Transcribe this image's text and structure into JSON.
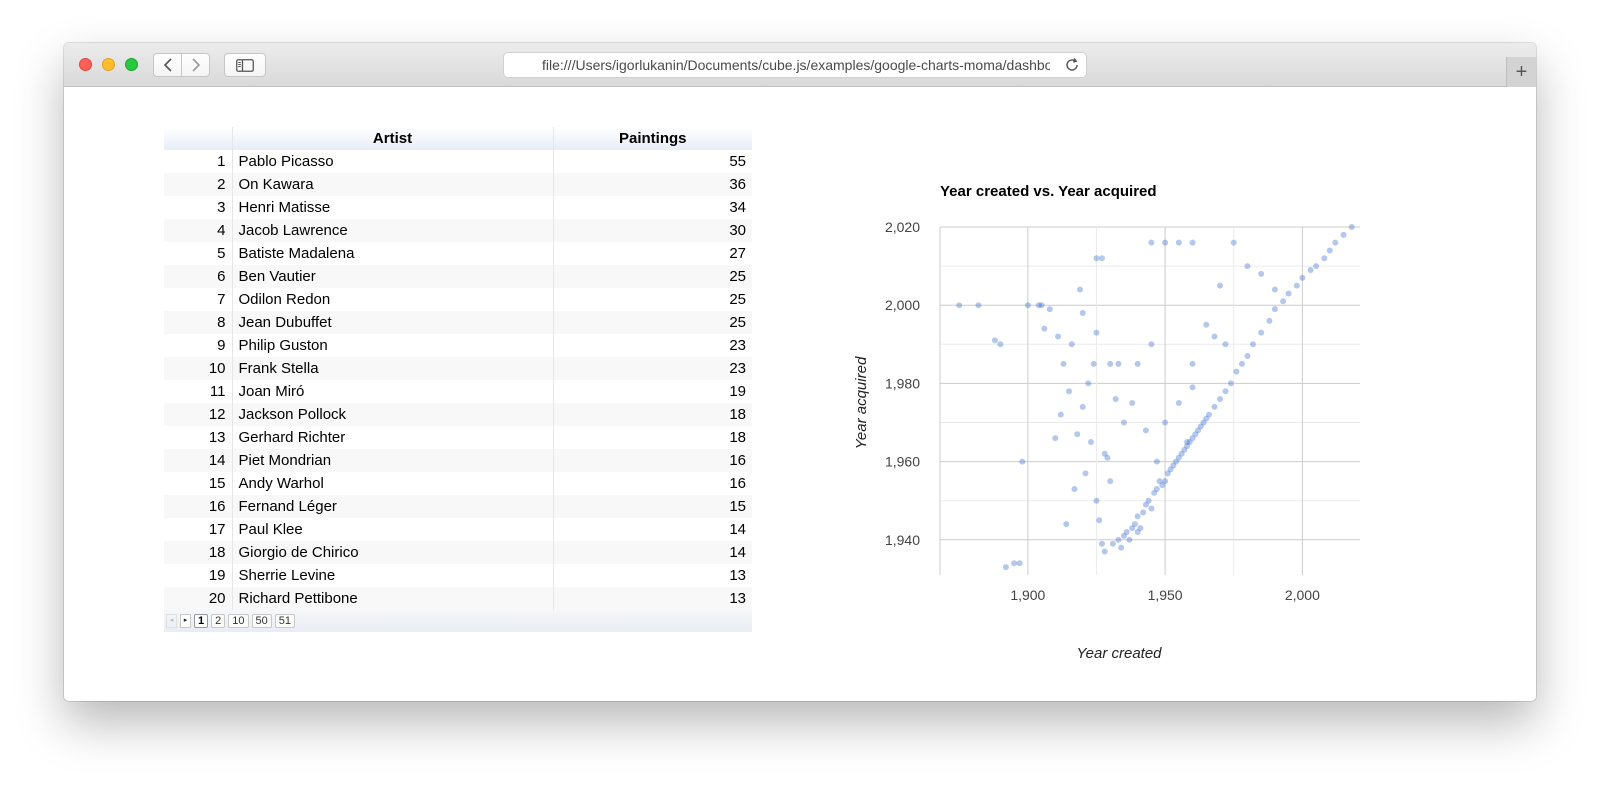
{
  "browser": {
    "url": "file:///Users/igorlukanin/Documents/cube.js/examples/google-charts-moma/dashboard.html",
    "new_tab_label": "+"
  },
  "table": {
    "headers": [
      "",
      "Artist",
      "Paintings"
    ],
    "rows": [
      {
        "index": "1",
        "artist": "Pablo Picasso",
        "paintings": "55"
      },
      {
        "index": "2",
        "artist": "On Kawara",
        "paintings": "36"
      },
      {
        "index": "3",
        "artist": "Henri Matisse",
        "paintings": "34"
      },
      {
        "index": "4",
        "artist": "Jacob Lawrence",
        "paintings": "30"
      },
      {
        "index": "5",
        "artist": "Batiste Madalena",
        "paintings": "27"
      },
      {
        "index": "6",
        "artist": "Ben Vautier",
        "paintings": "25"
      },
      {
        "index": "7",
        "artist": "Odilon Redon",
        "paintings": "25"
      },
      {
        "index": "8",
        "artist": "Jean Dubuffet",
        "paintings": "25"
      },
      {
        "index": "9",
        "artist": "Philip Guston",
        "paintings": "23"
      },
      {
        "index": "10",
        "artist": "Frank Stella",
        "paintings": "23"
      },
      {
        "index": "11",
        "artist": "Joan Miró",
        "paintings": "19"
      },
      {
        "index": "12",
        "artist": "Jackson Pollock",
        "paintings": "18"
      },
      {
        "index": "13",
        "artist": "Gerhard Richter",
        "paintings": "18"
      },
      {
        "index": "14",
        "artist": "Piet Mondrian",
        "paintings": "16"
      },
      {
        "index": "15",
        "artist": "Andy Warhol",
        "paintings": "16"
      },
      {
        "index": "16",
        "artist": "Fernand Léger",
        "paintings": "15"
      },
      {
        "index": "17",
        "artist": "Paul Klee",
        "paintings": "14"
      },
      {
        "index": "18",
        "artist": "Giorgio de Chirico",
        "paintings": "14"
      },
      {
        "index": "19",
        "artist": "Sherrie Levine",
        "paintings": "13"
      },
      {
        "index": "20",
        "artist": "Richard Pettibone",
        "paintings": "13"
      }
    ],
    "pager": {
      "prev_icon": "◂",
      "next_icon": "▸",
      "pages": [
        "1",
        "2",
        "10",
        "50",
        "51"
      ],
      "current": "1"
    }
  },
  "chart_data": {
    "type": "scatter",
    "title": "Year created vs. Year acquired",
    "xlabel": "Year created",
    "ylabel": "Year acquired",
    "xlim": [
      1868,
      2021
    ],
    "ylim": [
      1931,
      2020
    ],
    "x_ticks": [
      1900,
      1950,
      2000
    ],
    "x_tick_labels": [
      "1,900",
      "1,950",
      "2,000"
    ],
    "y_ticks": [
      1940,
      1960,
      1980,
      2000,
      2020
    ],
    "y_tick_labels": [
      "1,940",
      "1,960",
      "1,980",
      "2,000",
      "2,020"
    ],
    "grid": true,
    "point_color": "#3366cc",
    "point_opacity": 0.12,
    "series": [
      {
        "points": [
          [
            1875,
            2000
          ],
          [
            1882,
            2000
          ],
          [
            1888,
            1991
          ],
          [
            1890,
            1990
          ],
          [
            1892,
            1933
          ],
          [
            1895,
            1934
          ],
          [
            1897,
            1934
          ],
          [
            1900,
            2000
          ],
          [
            1904,
            2000
          ],
          [
            1906,
            1994
          ],
          [
            1908,
            1999
          ],
          [
            1910,
            1966
          ],
          [
            1912,
            1972
          ],
          [
            1913,
            1985
          ],
          [
            1914,
            1944
          ],
          [
            1916,
            1990
          ],
          [
            1917,
            1953
          ],
          [
            1918,
            1967
          ],
          [
            1919,
            2004
          ],
          [
            1920,
            1974
          ],
          [
            1921,
            1957
          ],
          [
            1922,
            1980
          ],
          [
            1923,
            1965
          ],
          [
            1924,
            1985
          ],
          [
            1925,
            1993
          ],
          [
            1926,
            1945
          ],
          [
            1927,
            1939
          ],
          [
            1928,
            1937
          ],
          [
            1929,
            1961
          ],
          [
            1930,
            1985
          ],
          [
            1931,
            1939
          ],
          [
            1932,
            1976
          ],
          [
            1933,
            1940
          ],
          [
            1934,
            1938
          ],
          [
            1935,
            1941
          ],
          [
            1936,
            1942
          ],
          [
            1937,
            1940
          ],
          [
            1938,
            1943
          ],
          [
            1939,
            1944
          ],
          [
            1940,
            1942
          ],
          [
            1940,
            1946
          ],
          [
            1941,
            1943
          ],
          [
            1942,
            1947
          ],
          [
            1943,
            1949
          ],
          [
            1944,
            1950
          ],
          [
            1945,
            1948
          ],
          [
            1946,
            1952
          ],
          [
            1947,
            1953
          ],
          [
            1948,
            1955
          ],
          [
            1949,
            1954
          ],
          [
            1950,
            1955
          ],
          [
            1951,
            1957
          ],
          [
            1952,
            1958
          ],
          [
            1953,
            1959
          ],
          [
            1954,
            1960
          ],
          [
            1955,
            1961
          ],
          [
            1956,
            1962
          ],
          [
            1957,
            1963
          ],
          [
            1958,
            1964
          ],
          [
            1959,
            1965
          ],
          [
            1960,
            1966
          ],
          [
            1961,
            1967
          ],
          [
            1962,
            1968
          ],
          [
            1963,
            1969
          ],
          [
            1964,
            1970
          ],
          [
            1965,
            1971
          ],
          [
            1966,
            1972
          ],
          [
            1968,
            1974
          ],
          [
            1970,
            1976
          ],
          [
            1972,
            1978
          ],
          [
            1974,
            1980
          ],
          [
            1976,
            1983
          ],
          [
            1978,
            1985
          ],
          [
            1980,
            1987
          ],
          [
            1982,
            1990
          ],
          [
            1985,
            1993
          ],
          [
            1988,
            1996
          ],
          [
            1990,
            1999
          ],
          [
            1993,
            2001
          ],
          [
            1995,
            2003
          ],
          [
            1998,
            2005
          ],
          [
            2000,
            2007
          ],
          [
            2003,
            2009
          ],
          [
            2005,
            2010
          ],
          [
            2008,
            2012
          ],
          [
            2010,
            2014
          ],
          [
            2012,
            2016
          ],
          [
            2015,
            2018
          ],
          [
            2018,
            2020
          ],
          [
            1950,
            1970
          ],
          [
            1955,
            1975
          ],
          [
            1960,
            1985
          ],
          [
            1965,
            1995
          ],
          [
            1970,
            2005
          ],
          [
            1975,
            2016
          ],
          [
            1980,
            2010
          ],
          [
            1985,
            2008
          ],
          [
            1990,
            2004
          ],
          [
            1945,
            1990
          ],
          [
            1940,
            1985
          ],
          [
            1935,
            1970
          ],
          [
            1930,
            1955
          ],
          [
            1925,
            1950
          ],
          [
            1945,
            2016
          ],
          [
            1950,
            2016
          ],
          [
            1955,
            2016
          ],
          [
            1960,
            2016
          ],
          [
            1925,
            2012
          ],
          [
            1927,
            2012
          ],
          [
            1968,
            1992
          ],
          [
            1972,
            1990
          ],
          [
            1960,
            1979
          ],
          [
            1958,
            1965
          ],
          [
            1947,
            1960
          ],
          [
            1943,
            1968
          ],
          [
            1938,
            1975
          ],
          [
            1933,
            1985
          ],
          [
            1928,
            1962
          ],
          [
            1920,
            1998
          ],
          [
            1915,
            1978
          ],
          [
            1911,
            1992
          ],
          [
            1905,
            2000
          ],
          [
            1898,
            1960
          ]
        ]
      }
    ]
  }
}
